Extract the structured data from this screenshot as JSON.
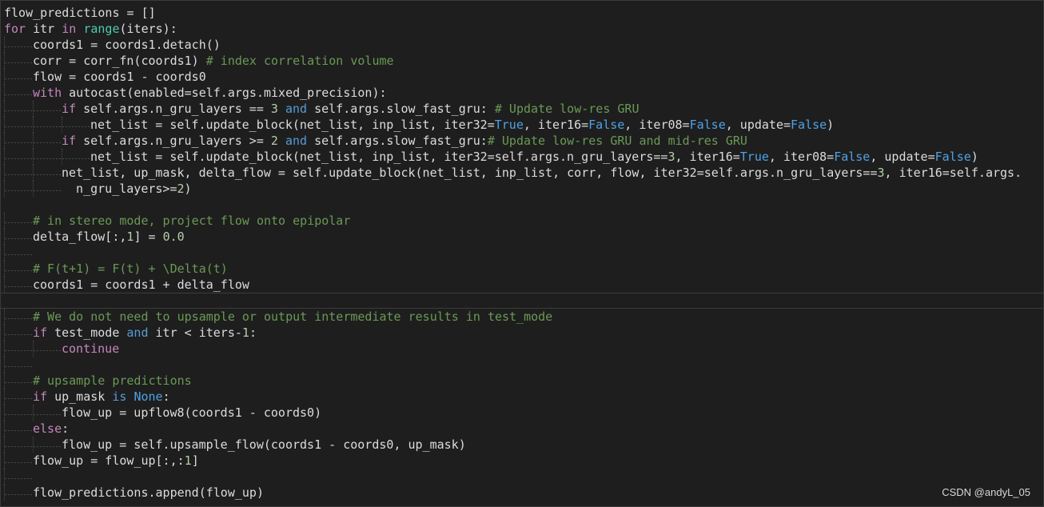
{
  "colors": {
    "background": "#1e1e1e",
    "default": "#dcdcdc",
    "keyword": "#c586c0",
    "operator_keyword": "#569cd6",
    "number": "#b5cea8",
    "boolean": "#4ea2e6",
    "comment": "#6a9955",
    "builtin": "#4ec9b0",
    "indent_guide": "#4a4a4a"
  },
  "watermark": "CSDN @andyL_05",
  "lines": [
    {
      "indent": 0,
      "tokens": [
        [
          "flow_predictions = []",
          "def"
        ]
      ]
    },
    {
      "indent": 0,
      "tokens": [
        [
          "for",
          "kw"
        ],
        [
          " itr ",
          "def"
        ],
        [
          "in",
          "kw"
        ],
        [
          " ",
          "def"
        ],
        [
          "range",
          "fn"
        ],
        [
          "(iters):",
          "def"
        ]
      ]
    },
    {
      "indent": 1,
      "tokens": [
        [
          "coords1 = coords1.detach()",
          "def"
        ]
      ]
    },
    {
      "indent": 1,
      "tokens": [
        [
          "corr = corr_fn(coords1) ",
          "def"
        ],
        [
          "# index correlation volume",
          "com"
        ]
      ]
    },
    {
      "indent": 1,
      "tokens": [
        [
          "flow = coords1 - coords0",
          "def"
        ]
      ]
    },
    {
      "indent": 1,
      "tokens": [
        [
          "with",
          "kw"
        ],
        [
          " autocast(enabled=self.args.mixed_precision):",
          "def"
        ]
      ]
    },
    {
      "indent": 2,
      "tokens": [
        [
          "if",
          "kw"
        ],
        [
          " self.args.n_gru_layers == ",
          "def"
        ],
        [
          "3",
          "num"
        ],
        [
          " ",
          "def"
        ],
        [
          "and",
          "op"
        ],
        [
          " self.args.slow_fast_gru: ",
          "def"
        ],
        [
          "# Update low-res GRU",
          "com"
        ]
      ]
    },
    {
      "indent": 3,
      "tokens": [
        [
          "net_list = self.update_block(net_list, inp_list, iter32=",
          "def"
        ],
        [
          "True",
          "bool"
        ],
        [
          ", iter16=",
          "def"
        ],
        [
          "False",
          "bool"
        ],
        [
          ", iter08=",
          "def"
        ],
        [
          "False",
          "bool"
        ],
        [
          ", update=",
          "def"
        ],
        [
          "False",
          "bool"
        ],
        [
          ")",
          "def"
        ]
      ]
    },
    {
      "indent": 2,
      "tokens": [
        [
          "if",
          "kw"
        ],
        [
          " self.args.n_gru_layers >= ",
          "def"
        ],
        [
          "2",
          "num"
        ],
        [
          " ",
          "def"
        ],
        [
          "and",
          "op"
        ],
        [
          " self.args.slow_fast_gru:",
          "def"
        ],
        [
          "# Update low-res GRU and mid-res GRU",
          "com"
        ]
      ]
    },
    {
      "indent": 3,
      "tokens": [
        [
          "net_list = self.update_block(net_list, inp_list, iter32=self.args.n_gru_layers==",
          "def"
        ],
        [
          "3",
          "num"
        ],
        [
          ", iter16=",
          "def"
        ],
        [
          "True",
          "bool"
        ],
        [
          ", iter08=",
          "def"
        ],
        [
          "False",
          "bool"
        ],
        [
          ", update=",
          "def"
        ],
        [
          "False",
          "bool"
        ],
        [
          ")",
          "def"
        ]
      ]
    },
    {
      "indent": 2,
      "tokens": [
        [
          "net_list, up_mask, delta_flow = self.update_block(net_list, inp_list, corr, flow, iter32=self.args.n_gru_layers==",
          "def"
        ],
        [
          "3",
          "num"
        ],
        [
          ", iter16=self.args.",
          "def"
        ]
      ]
    },
    {
      "indent": 2,
      "wrap": true,
      "tokens": [
        [
          "  n_gru_layers>=",
          "def"
        ],
        [
          "2",
          "num"
        ],
        [
          ")",
          "def"
        ]
      ]
    },
    {
      "indent": 0,
      "tokens": []
    },
    {
      "indent": 1,
      "tokens": [
        [
          "# in stereo mode, project flow onto epipolar",
          "com"
        ]
      ]
    },
    {
      "indent": 1,
      "tokens": [
        [
          "delta_flow[:,",
          "def"
        ],
        [
          "1",
          "num"
        ],
        [
          "] = ",
          "def"
        ],
        [
          "0.0",
          "num"
        ]
      ]
    },
    {
      "indent": 1,
      "tokens": []
    },
    {
      "indent": 1,
      "tokens": [
        [
          "# F(t+1) = F(t) + \\Delta(t)",
          "com"
        ]
      ]
    },
    {
      "indent": 1,
      "tokens": [
        [
          "coords1 = coords1 + delta_flow",
          "def"
        ]
      ]
    },
    {
      "indent": 0,
      "current": true,
      "tokens": []
    },
    {
      "indent": 1,
      "tokens": [
        [
          "# We do not need to upsample or output intermediate results in test_mode",
          "com"
        ]
      ]
    },
    {
      "indent": 1,
      "tokens": [
        [
          "if",
          "kw"
        ],
        [
          " test_mode ",
          "def"
        ],
        [
          "and",
          "op"
        ],
        [
          " itr < iters-",
          "def"
        ],
        [
          "1",
          "num"
        ],
        [
          ":",
          "def"
        ]
      ]
    },
    {
      "indent": 2,
      "tokens": [
        [
          "continue",
          "kw"
        ]
      ]
    },
    {
      "indent": 1,
      "tokens": []
    },
    {
      "indent": 1,
      "tokens": [
        [
          "# upsample predictions",
          "com"
        ]
      ]
    },
    {
      "indent": 1,
      "tokens": [
        [
          "if",
          "kw"
        ],
        [
          " up_mask ",
          "def"
        ],
        [
          "is",
          "op"
        ],
        [
          " ",
          "def"
        ],
        [
          "None",
          "bool"
        ],
        [
          ":",
          "def"
        ]
      ]
    },
    {
      "indent": 2,
      "tokens": [
        [
          "flow_up = upflow8(coords1 - coords0)",
          "def"
        ]
      ]
    },
    {
      "indent": 1,
      "tokens": [
        [
          "else",
          "kw"
        ],
        [
          ":",
          "def"
        ]
      ]
    },
    {
      "indent": 2,
      "tokens": [
        [
          "flow_up = self.upsample_flow(coords1 - coords0, up_mask)",
          "def"
        ]
      ]
    },
    {
      "indent": 1,
      "tokens": [
        [
          "flow_up = flow_up[:,:",
          "def"
        ],
        [
          "1",
          "num"
        ],
        [
          "]",
          "def"
        ]
      ]
    },
    {
      "indent": 1,
      "tokens": []
    },
    {
      "indent": 1,
      "tokens": [
        [
          "flow_predictions.append(flow_up)",
          "def"
        ]
      ]
    }
  ]
}
